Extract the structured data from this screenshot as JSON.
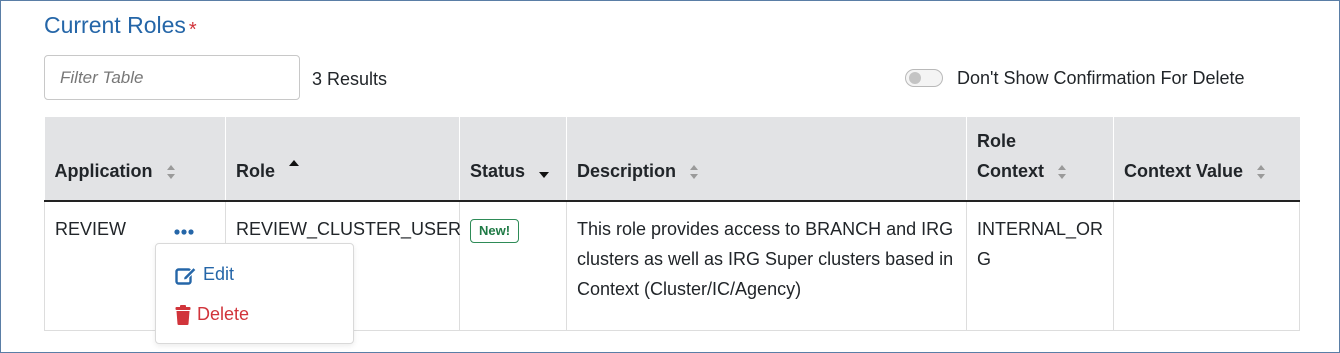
{
  "section": {
    "title": "Current Roles",
    "required_marker": "*"
  },
  "filter": {
    "placeholder": "Filter Table",
    "value": ""
  },
  "results_text": "3 Results",
  "confirm_toggle": {
    "label": "Don't Show Confirmation For Delete",
    "enabled": false
  },
  "table": {
    "headers": {
      "application": "Application",
      "role": "Role",
      "status": "Status",
      "description": "Description",
      "role_context_line1": "Role",
      "role_context_line2": "Context",
      "context_value": "Context Value"
    },
    "rows": [
      {
        "application": "REVIEW",
        "role": "REVIEW_CLUSTER_USER",
        "status": "New!",
        "description": "This role provides access to BRANCH and IRG clusters as well as IRG Super clusters based in Context (Cluster/IC/Agency)",
        "role_context_line1": "INTERNAL_OR",
        "role_context_line2": "G",
        "context_value": ""
      }
    ]
  },
  "row_menu": {
    "edit_label": "Edit",
    "delete_label": "Delete"
  },
  "colors": {
    "accent": "#2566a8",
    "danger": "#d1343b",
    "success": "#1f7a45",
    "header_bg": "#e2e3e5"
  }
}
